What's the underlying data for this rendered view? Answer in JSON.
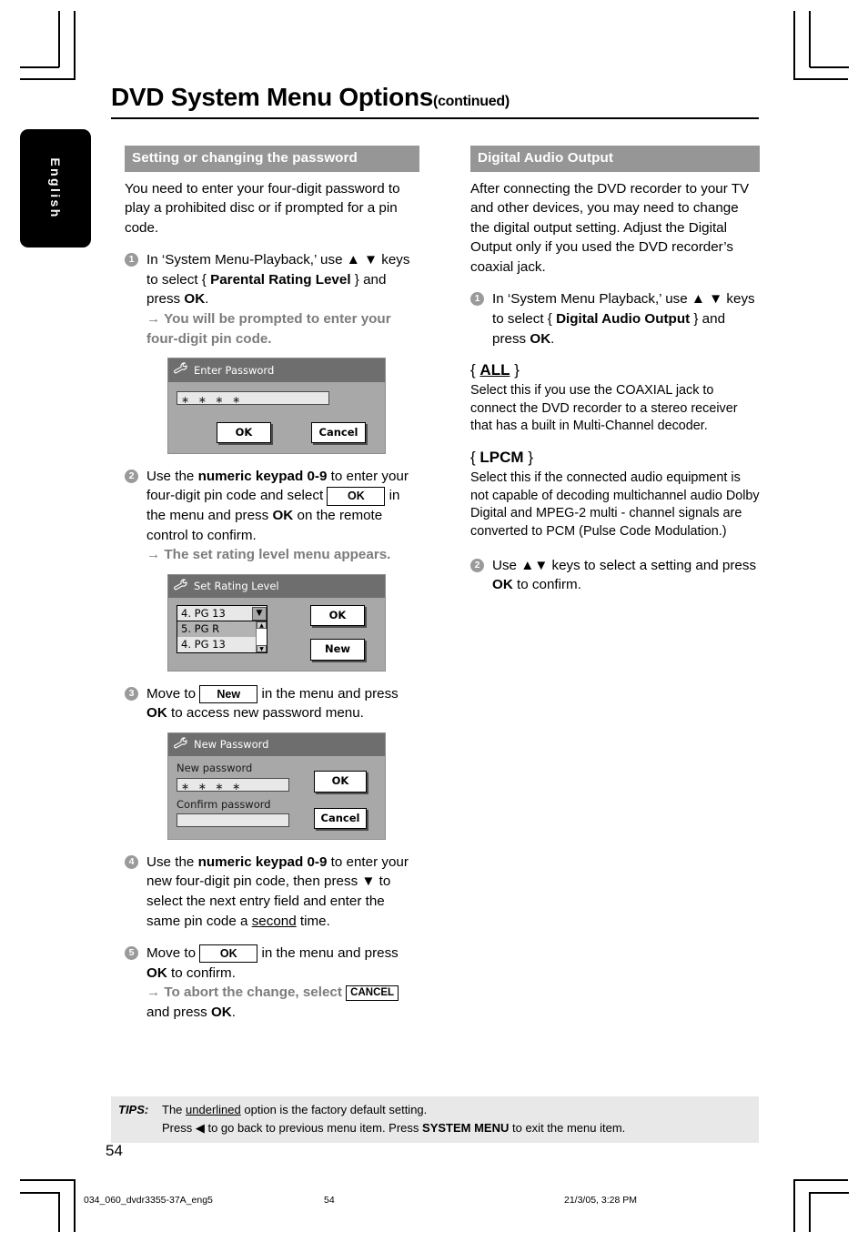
{
  "language_tab": {
    "label": "English"
  },
  "header": {
    "title": "DVD System Menu Options",
    "continued": "(continued)"
  },
  "left_column": {
    "section_title": "Setting or changing the password",
    "intro": "You need to enter your four-digit password to play a prohibited disc or if prompted for a pin code.",
    "step1": {
      "num": "1",
      "text_a": "In ‘System Menu-Playback,’ use ▲ ▼ keys to select {",
      "bold": "Parental Rating Level",
      "text_b": "} and press",
      "bold2": "OK",
      "period": ".",
      "result": "→ You will be prompted to enter your four-digit pin code."
    },
    "osd_enter_password": {
      "title": "Enter Password",
      "icon": "wrench-icon",
      "password_value": "∗ ∗ ∗ ∗",
      "ok_label": "OK",
      "cancel_label": "Cancel"
    },
    "step2": {
      "num": "2",
      "text_a": "Use the",
      "bold": "numeric keypad 0-9",
      "text_b": "to enter your four-digit pin code and select",
      "key_ok": "OK",
      "text_c": "in the menu and press",
      "bold2": "OK",
      "text_d": "on the remote control to confirm.",
      "result": "→ The set rating level menu appears."
    },
    "osd_set_rating": {
      "title": "Set Rating Level",
      "icon": "wrench-icon",
      "selected": "4.  PG 13",
      "options": [
        "5.  PG R",
        "4.  PG 13"
      ],
      "ok_label": "OK",
      "new_label": "New"
    },
    "step3": {
      "num": "3",
      "text_a": "Move to",
      "key_new": "New",
      "text_b": "in the menu and press",
      "bold": "OK",
      "text_c": "to access new password menu."
    },
    "osd_new_password": {
      "title": "New Password",
      "icon": "wrench-icon",
      "new_label": "New password",
      "new_value": "∗ ∗ ∗ ∗",
      "confirm_label": "Confirm password",
      "confirm_value": "",
      "ok_label": "OK",
      "cancel_label": "Cancel"
    },
    "step4": {
      "num": "4",
      "text_a": "Use the",
      "bold": "numeric keypad 0-9",
      "text_b": "to enter your new four-digit pin code, then press ▼ to select the next entry field and enter the same pin code a",
      "underlined": "second",
      "text_c": "time."
    },
    "step5": {
      "num": "5",
      "text_a": "Move to",
      "key_ok": "OK",
      "text_b": "in the menu and press",
      "bold": "OK",
      "text_c": "to confirm.",
      "result_a": "→ To abort the change, select",
      "key_cancel": "CANCEL",
      "result_b": "and press",
      "bold2": "OK",
      "result_c": "."
    }
  },
  "right_column": {
    "section_title": "Digital Audio Output",
    "intro": "After connecting the DVD recorder to your TV and other devices, you may need to change the digital output setting. Adjust the Digital Output only if you used the DVD recorder’s coaxial jack.",
    "step1": {
      "num": "1",
      "text_a": "In ‘System Menu Playback,’ use ▲ ▼ keys to select {",
      "bold": "Digital Audio Output",
      "text_b": "} and press",
      "bold2": "OK",
      "period": "."
    },
    "option_all": {
      "brace_open": "{",
      "value": "ALL",
      "brace_close": "}",
      "body": "Select this if you use the COAXIAL jack to connect the DVD recorder to a stereo receiver that has a built in Multi-Channel decoder."
    },
    "option_lpcm": {
      "brace_open": "{",
      "value": "LPCM",
      "brace_close": "}",
      "body": "Select this if the connected audio equipment is not capable of decoding multichannel audio Dolby Digital and MPEG-2 multi - channel signals are converted to PCM (Pulse Code Modulation.)"
    },
    "step2": {
      "num": "2",
      "text_a": "Use ▲▼ keys to select a setting and press",
      "bold": "OK",
      "text_b": "to confirm."
    }
  },
  "tips": {
    "label": "TIPS:",
    "line1_a": "The",
    "line1_underlined": "underlined",
    "line1_b": "option is the factory default setting.",
    "line2_a": "Press ◀  to go back to previous menu item. Press",
    "line2_bold": "SYSTEM MENU",
    "line2_b": "to exit the menu item."
  },
  "page_number": "54",
  "print_bar": {
    "file": "034_060_dvdr3355-37A_eng5",
    "page": "54",
    "date": "21/3/05, 3:28 PM"
  },
  "colors": {
    "section_bar": "#969696",
    "osd_title": "#6e6e6e",
    "osd_body": "#a8a8a8",
    "tips_bg": "#e8e8e8",
    "bullet": "#9a9a9a"
  }
}
